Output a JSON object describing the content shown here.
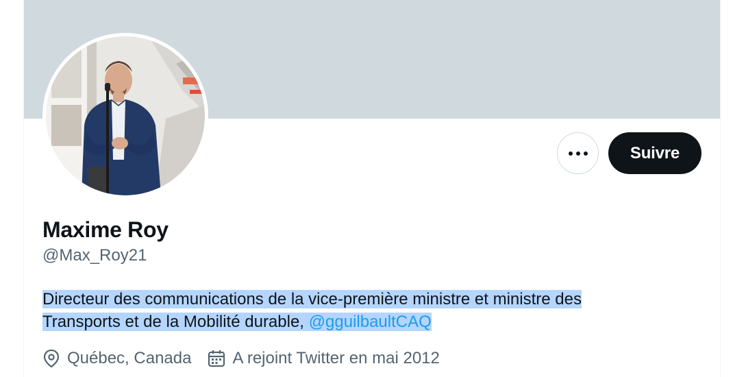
{
  "profile": {
    "name": "Maxime Roy",
    "handle": "@Max_Roy21",
    "bio_line1": "Directeur des communications de la vice-première ministre et ministre des",
    "bio_line2_prefix": "Transports et de la Mobilité durable,",
    "bio_mention": "@gguilbaultCAQ",
    "location": "Québec, Canada",
    "joined": "A rejoint Twitter en mai 2012"
  },
  "actions": {
    "more_icon": "more-horizontal-icon",
    "follow_label": "Suivre"
  },
  "icons": {
    "location": "location-pin-icon",
    "joined": "calendar-icon"
  },
  "colors": {
    "banner": "#cfd9de",
    "follow_button": "#0f1419",
    "mention": "#1d9bf0",
    "secondary_text": "#536471",
    "text_selection": "#b4d5fe"
  }
}
